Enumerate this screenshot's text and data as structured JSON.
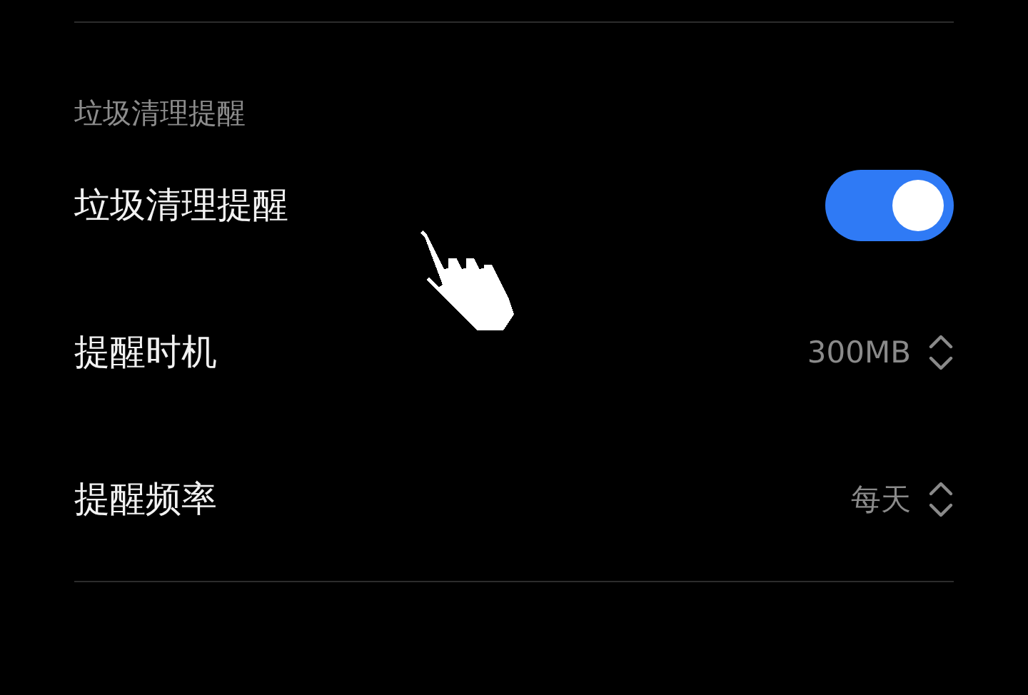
{
  "section": {
    "title": "垃圾清理提醒"
  },
  "rows": [
    {
      "kind": "toggle",
      "label": "垃圾清理提醒",
      "on": true
    },
    {
      "kind": "picker",
      "label": "提醒时机",
      "value": "300MB"
    },
    {
      "kind": "picker",
      "label": "提醒频率",
      "value": "每天"
    }
  ]
}
